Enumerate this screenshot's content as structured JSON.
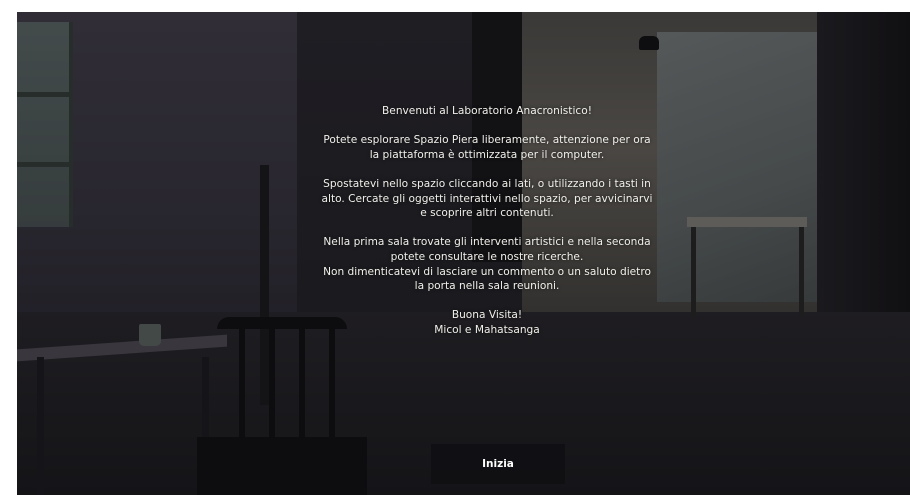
{
  "welcome": {
    "title": "Benvenuti al Laboratorio Anacronistico!",
    "intro_lines": [
      "Potete esplorare Spazio Piera liberamente, attenzione per ora",
      "la piattaforma è ottimizzata per il computer."
    ],
    "navigation_lines": [
      "Spostatevi nello spazio cliccando ai lati, o utilizzando i tasti in",
      "alto. Cercate gli oggetti interattivi nello spazio, per avvicinarvi",
      "e scoprire altri contenuti."
    ],
    "rooms_lines": [
      "Nella prima sala trovate gli interventi artistici e nella seconda",
      "potete consultare le nostre ricerche.",
      "Non dimenticatevi di lasciare un commento o un saluto dietro",
      "la porta nella sala reunioni."
    ],
    "closing": "Buona Visita!",
    "signature": "Micol e Mahatsanga"
  },
  "start_button": {
    "label": "Inizia"
  }
}
